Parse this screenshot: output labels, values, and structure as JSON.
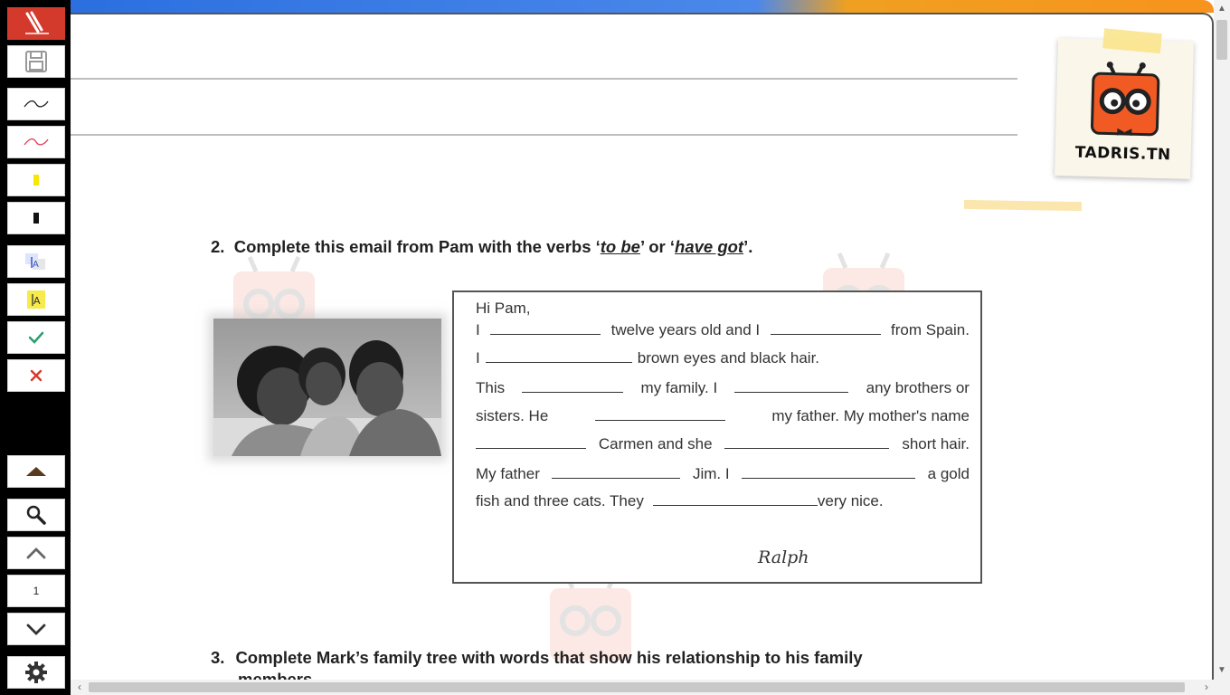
{
  "toolbar": {
    "page_number": "1"
  },
  "logo": {
    "brand": "TADRIS.TN"
  },
  "exercise2": {
    "number": "2.",
    "text_before": "Complete this email from Pam with the verbs ‘",
    "verb1": "to be",
    "text_mid": "’ or ‘",
    "verb2": "have got",
    "text_after": "’."
  },
  "email": {
    "greeting": "Hi Pam,",
    "l1": {
      "a": "I",
      "b": "twelve years old and I",
      "c": "from Spain."
    },
    "l2": {
      "a": "I",
      "b": "brown eyes and black hair."
    },
    "l3": {
      "a": "This",
      "b": "my family. I",
      "c": "any brothers or"
    },
    "l4": {
      "a": "sisters.  He",
      "b": "my father. My mother's name"
    },
    "l5": {
      "b": "Carmen and she",
      "c": "short hair."
    },
    "l6": {
      "a": "My father",
      "b": "Jim. I",
      "c": "a gold"
    },
    "l7": {
      "a": "fish and three cats. They",
      "b": "very nice."
    },
    "signature": "Ralph"
  },
  "exercise3": {
    "number": "3.",
    "text": "Complete Mark’s family tree  with words that  show  his  relationship to his family",
    "text_cont": "members."
  },
  "colors": {
    "accent_red": "#d33a2c",
    "check_green": "#2a9d6e",
    "topbar_blue": "#2b6fe0",
    "topbar_orange": "#f7931e",
    "logo_orange": "#f25a24"
  }
}
